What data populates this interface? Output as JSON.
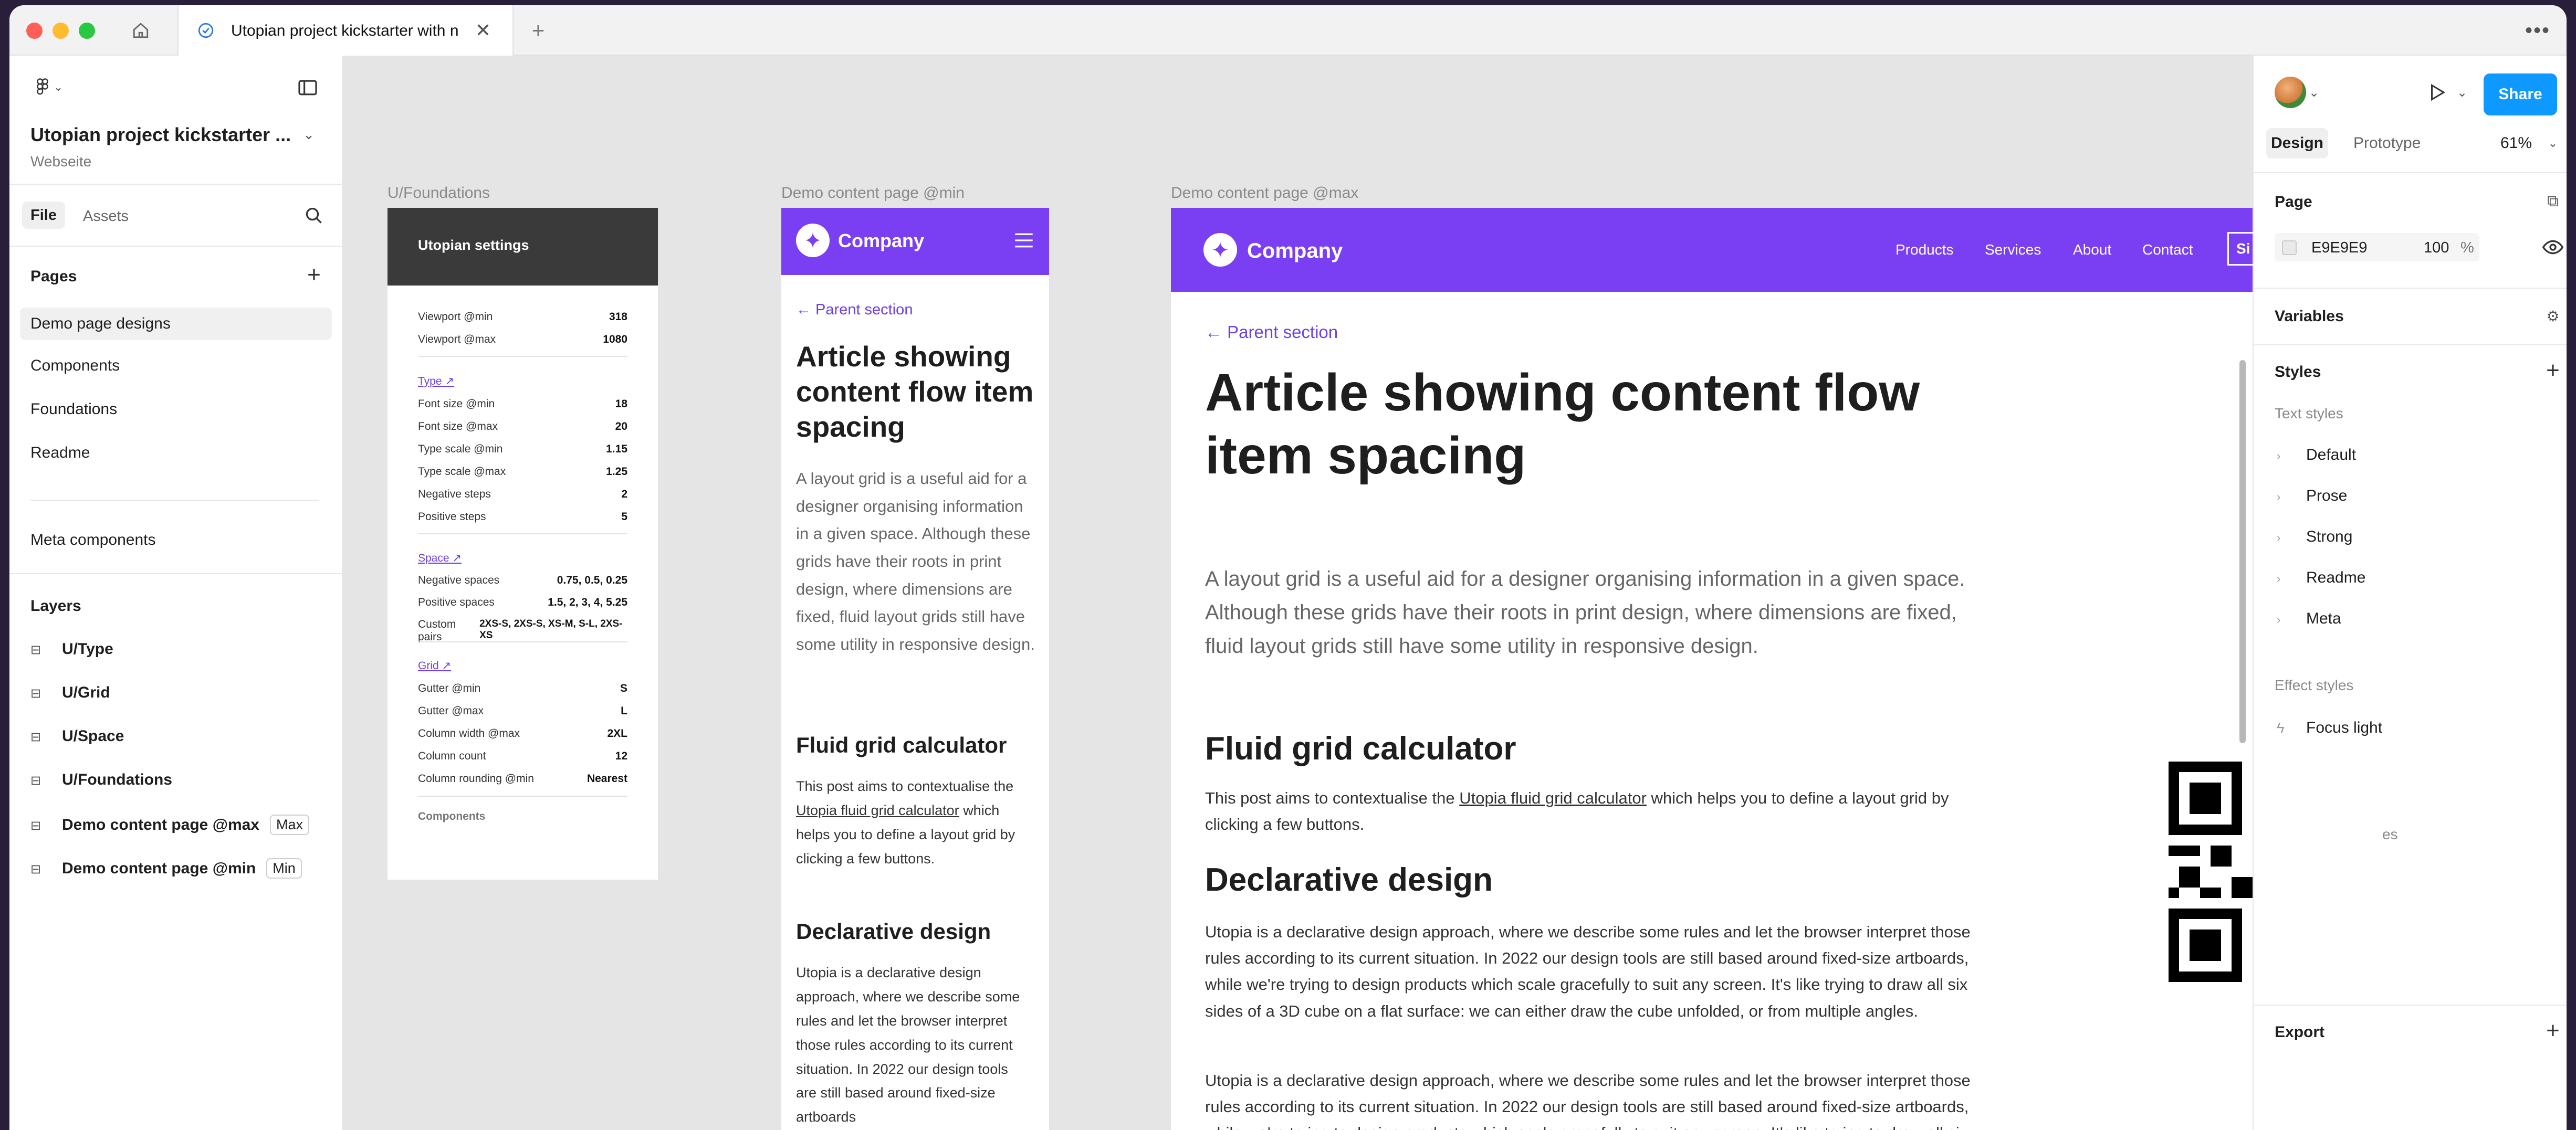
{
  "browser": {
    "tab_title": "Utopian project kickstarter with n"
  },
  "left": {
    "project_title": "Utopian project kickstarter ...",
    "subtitle": "Webseite",
    "tabs": [
      "File",
      "Assets"
    ],
    "pages_label": "Pages",
    "pages": [
      "Demo page designs",
      "Components",
      "Foundations",
      "Readme"
    ],
    "meta": "Meta components",
    "layers_label": "Layers",
    "layers": [
      {
        "name": "U/Type",
        "badge": ""
      },
      {
        "name": "U/Grid",
        "badge": ""
      },
      {
        "name": "U/Space",
        "badge": ""
      },
      {
        "name": "U/Foundations",
        "badge": ""
      },
      {
        "name": "Demo content page @max",
        "badge": "Max"
      },
      {
        "name": "Demo content page @min",
        "badge": "Min"
      }
    ]
  },
  "canvas": {
    "foundations": {
      "label": "U/Foundations",
      "title": "Utopian settings",
      "rows1": [
        [
          "Viewport @min",
          "318"
        ],
        [
          "Viewport @max",
          "1080"
        ]
      ],
      "type_link": "Type ↗",
      "rows2": [
        [
          "Font size @min",
          "18"
        ],
        [
          "Font size @max",
          "20"
        ],
        [
          "Type scale @min",
          "1.15"
        ],
        [
          "Type scale @max",
          "1.25"
        ],
        [
          "Negative steps",
          "2"
        ],
        [
          "Positive steps",
          "5"
        ]
      ],
      "space_link": "Space ↗",
      "rows3": [
        [
          "Negative spaces",
          "0.75, 0.5, 0.25"
        ],
        [
          "Positive spaces",
          "1.5, 2, 3, 4, 5.25"
        ],
        [
          "Custom pairs",
          "2XS-S, 2XS-S, XS-M, S-L, 2XS-XS"
        ]
      ],
      "grid_link": "Grid ↗",
      "rows4": [
        [
          "Gutter @min",
          "S"
        ],
        [
          "Gutter @max",
          "L"
        ],
        [
          "Column width @max",
          "2XL"
        ],
        [
          "Column count",
          "12"
        ],
        [
          "Column rounding @min",
          "Nearest"
        ]
      ],
      "components": "Components"
    },
    "min": {
      "label": "Demo content page @min",
      "company": "Company",
      "parent": "← Parent section",
      "h1": "Article showing content flow item spacing",
      "lead": "A layout grid is a useful aid for a designer organising information in a given space. Although these grids have their roots in print design, where dimensions are fixed, fluid layout grids still have some utility in responsive design.",
      "h2a": "Fluid grid calculator",
      "p1a": "This post aims to contextualise the",
      "p1link": "Utopia fluid grid calculator",
      "p1b": "which helps you to define a layout grid by clicking a few buttons.",
      "h2b": "Declarative design",
      "p2": "Utopia is a declarative design approach, where we describe some rules and let the browser interpret those rules according to its current situation. In 2022 our design tools are still based around fixed-size artboards"
    },
    "max": {
      "label": "Demo content page @max",
      "company": "Company",
      "nav": [
        "Products",
        "Services",
        "About",
        "Contact"
      ],
      "nav_btn": "Si",
      "parent": "← Parent section",
      "h1": "Article showing content flow item spacing",
      "lead": "A layout grid is a useful aid for a designer organising information in a given space. Although these grids have their roots in print design, where dimensions are fixed, fluid layout grids still have some utility in responsive design.",
      "h2a": "Fluid grid calculator",
      "p1a": "This post aims to contextualise the",
      "p1link": "Utopia fluid grid calculator",
      "p1b": "which helps you to define a layout grid by clicking a few buttons.",
      "h2b": "Declarative design",
      "p2": "Utopia is a declarative design approach, where we describe some rules and let the browser interpret those rules according to its current situation. In 2022 our design tools are still based around fixed-size artboards, while we're trying to design products which scale gracefully to suit any screen. It's like trying to draw all six sides of a 3D cube on a flat surface: we can either draw the cube unfolded, or from multiple angles.",
      "p3": "Utopia is a declarative design approach, where we describe some rules and let the browser interpret those rules according to its current situation. In 2022 our design tools are still based around fixed-size artboards, while we're trying to design products which scale gracefully to suit any screen. It's like trying to draw all six sides of a 3D cube on a flat surface: we can either draw"
    }
  },
  "right": {
    "share": "Share",
    "tabs": [
      "Design",
      "Prototype"
    ],
    "zoom": "61%",
    "page_label": "Page",
    "bg_hex": "E9E9E9",
    "bg_opacity": "100",
    "pct": "%",
    "variables": "Variables",
    "styles": "Styles",
    "text_styles_label": "Text styles",
    "text_styles": [
      "Default",
      "Prose",
      "Strong",
      "Readme",
      "Meta"
    ],
    "effect_styles_label": "Effect styles",
    "effect": "Focus light",
    "partial": "es",
    "export": "Export"
  },
  "colors": {
    "accent": "#7a3ff2",
    "share": "#0d99ff",
    "link": "#6b40e8"
  }
}
